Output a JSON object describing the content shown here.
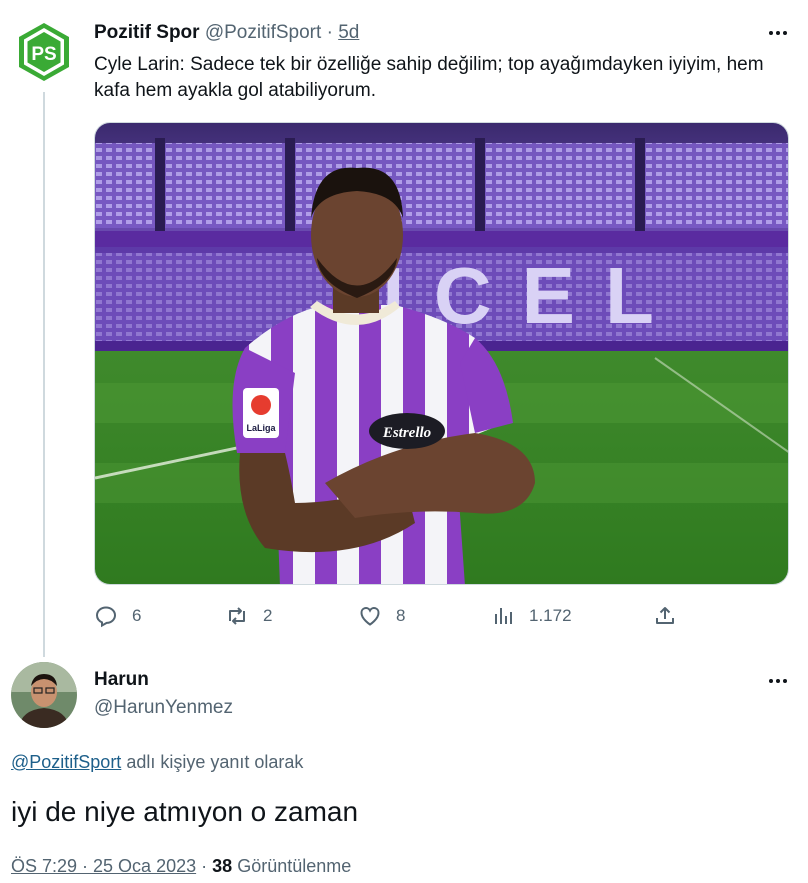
{
  "tweet": {
    "author_name": "Pozitif Spor",
    "author_handle": "@PozitifSport",
    "separator": "·",
    "time": "5d",
    "text": "Cyle Larin: Sadece tek bir özelliğe sahip değilim; top ayağımdayken iyiyim, hem kafa hem ayakla gol atabiliyorum.",
    "avatar_text": "PS",
    "media": {
      "banner_text": "UCEL",
      "sponsor_text": "Estrello",
      "badge_text": "LaLiga"
    },
    "actions": {
      "reply_count": "6",
      "retweet_count": "2",
      "like_count": "8",
      "views_count": "1.172"
    },
    "colors": {
      "avatar_green": "#3aaa35",
      "kit_purple": "#8a3fc4"
    }
  },
  "reply": {
    "author_name": "Harun",
    "author_handle": "@HarunYenmez",
    "replying_handle": "@PozitifSport",
    "replying_suffix": "adlı kişiye yanıt olarak",
    "text": "iyi de niye atmıyon o zaman",
    "timestamp": "ÖS 7:29 · 25 Oca 2023",
    "meta_separator": "·",
    "views_count": "38",
    "views_label": "Görüntülenme"
  }
}
